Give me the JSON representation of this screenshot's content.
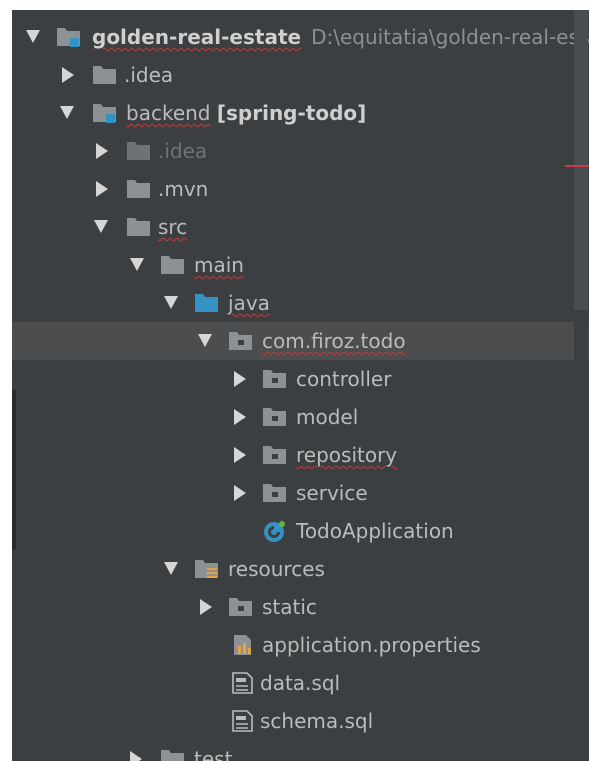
{
  "tree": [
    {
      "id": "golden-real-estate",
      "label": "golden-real-estate",
      "suffix": "",
      "path": "D:\\equitatia\\golden-real-estate",
      "expanded": true,
      "depth": 0,
      "icon": "module-folder-icon",
      "style": "bold"
    },
    {
      "id": "idea-root",
      "label": ".idea",
      "expanded": false,
      "depth": 1,
      "icon": "folder-icon"
    },
    {
      "id": "backend",
      "label": "backend",
      "suffix": "[spring-todo]",
      "expanded": true,
      "depth": 1,
      "icon": "module-folder-icon"
    },
    {
      "id": "idea-backend",
      "label": ".idea",
      "expanded": false,
      "depth": 2,
      "icon": "folder-icon",
      "style": "muted"
    },
    {
      "id": "mvn",
      "label": ".mvn",
      "expanded": false,
      "depth": 2,
      "icon": "folder-icon"
    },
    {
      "id": "src",
      "label": "src",
      "expanded": true,
      "depth": 2,
      "icon": "folder-icon"
    },
    {
      "id": "main",
      "label": "main",
      "expanded": true,
      "depth": 3,
      "icon": "folder-icon"
    },
    {
      "id": "java",
      "label": "java",
      "expanded": true,
      "depth": 4,
      "icon": "source-folder-icon"
    },
    {
      "id": "com-firoz-todo",
      "label": "com.firoz.todo",
      "expanded": true,
      "depth": 5,
      "icon": "package-icon",
      "selected": true
    },
    {
      "id": "controller",
      "label": "controller",
      "expanded": false,
      "depth": 6,
      "icon": "package-icon"
    },
    {
      "id": "model",
      "label": "model",
      "expanded": false,
      "depth": 6,
      "icon": "package-icon"
    },
    {
      "id": "repository",
      "label": "repository",
      "expanded": false,
      "depth": 6,
      "icon": "package-icon"
    },
    {
      "id": "service",
      "label": "service",
      "expanded": false,
      "depth": 6,
      "icon": "package-icon"
    },
    {
      "id": "todo-application",
      "label": "TodoApplication",
      "depth": 6,
      "icon": "spring-class-icon",
      "leaf": true
    },
    {
      "id": "resources",
      "label": "resources",
      "expanded": true,
      "depth": 4,
      "icon": "resources-folder-icon"
    },
    {
      "id": "static",
      "label": "static",
      "expanded": false,
      "depth": 5,
      "icon": "package-icon"
    },
    {
      "id": "application-properties",
      "label": "application.properties",
      "depth": 5,
      "icon": "properties-file-icon",
      "leaf": true
    },
    {
      "id": "data-sql",
      "label": "data.sql",
      "depth": 5,
      "icon": "sql-file-icon",
      "leaf": true
    },
    {
      "id": "schema-sql",
      "label": "schema.sql",
      "depth": 5,
      "icon": "sql-file-icon",
      "leaf": true
    },
    {
      "id": "test",
      "label": "test",
      "expanded": false,
      "depth": 3,
      "icon": "folder-icon"
    }
  ],
  "colors": {
    "panel_bg": "#3c3f41",
    "selection_bg": "#4b4d4f",
    "text": "#bbbbbb",
    "folder": "#8c9196",
    "source_folder": "#3592c4",
    "spell_underline": "#bc3f3c"
  }
}
